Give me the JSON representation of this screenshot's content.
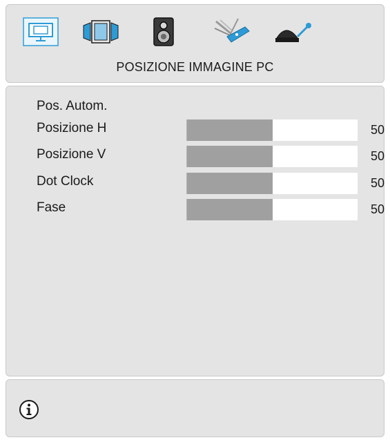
{
  "header": {
    "title": "POSIZIONE IMMAGINE PC",
    "tabs": [
      {
        "icon": "monitor-icon",
        "selected": true
      },
      {
        "icon": "display-panels-icon",
        "selected": false
      },
      {
        "icon": "speaker-icon",
        "selected": false
      },
      {
        "icon": "swiss-knife-icon",
        "selected": false
      },
      {
        "icon": "satellite-dish-icon",
        "selected": false
      }
    ]
  },
  "main": {
    "items": [
      {
        "label": "Pos. Autom."
      },
      {
        "label": "Posizione H",
        "value": "50",
        "level": 0.5
      },
      {
        "label": "Posizione V",
        "value": "50",
        "level": 0.5
      },
      {
        "label": "Dot Clock",
        "value": "50",
        "level": 0.5
      },
      {
        "label": "Fase",
        "value": "50",
        "level": 0.5
      }
    ]
  },
  "footer": {
    "icon": "info-icon"
  },
  "colors": {
    "panel": "#e4e4e4",
    "fill": "#a0a0a0",
    "bar": "#ffffff",
    "selected_icon_bg": "#eaf6fb",
    "icon_blue": "#2e9bd6"
  }
}
